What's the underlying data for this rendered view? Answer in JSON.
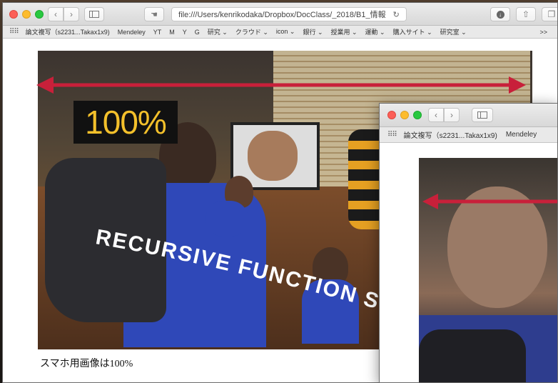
{
  "main_window": {
    "url": "file:///Users/kenrikodaka/Dropbox/DocClass/_2018/B1_情報",
    "bookmarks": [
      "論文複写（s2231...Takax1x9)",
      "Mendeley",
      "YT",
      "M",
      "Y",
      "G",
      "研究 ⌄",
      "クラウド ⌄",
      "icon ⌄",
      "銀行 ⌄",
      "授業用 ⌄",
      "運動 ⌄",
      "購入サイト ⌄",
      "研究室 ⌄"
    ],
    "overflow": ">>",
    "hero_percent": "100%",
    "hero_banner": "RECURSIVE FUNCTION SPACE",
    "caption": "スマホ用画像は100%"
  },
  "nested_window": {
    "bookmarks": [
      "論文複写（s2231...Takax1x9)",
      "Mendeley"
    ]
  },
  "colors": {
    "arrow": "#c8203a",
    "percent_text": "#f3c02b",
    "traffic_red": "#fc5f57",
    "traffic_yellow": "#fdbc2e",
    "traffic_green": "#28c840"
  },
  "icons": {
    "back": "chevron-left-icon",
    "forward": "chevron-right-icon",
    "sidebar": "sidebar-icon",
    "extension": "hand-icon",
    "reload": "reload-icon",
    "download": "download-icon",
    "share": "share-icon",
    "tabs": "tabs-icon",
    "bookmarks_grid": "grid-icon"
  }
}
